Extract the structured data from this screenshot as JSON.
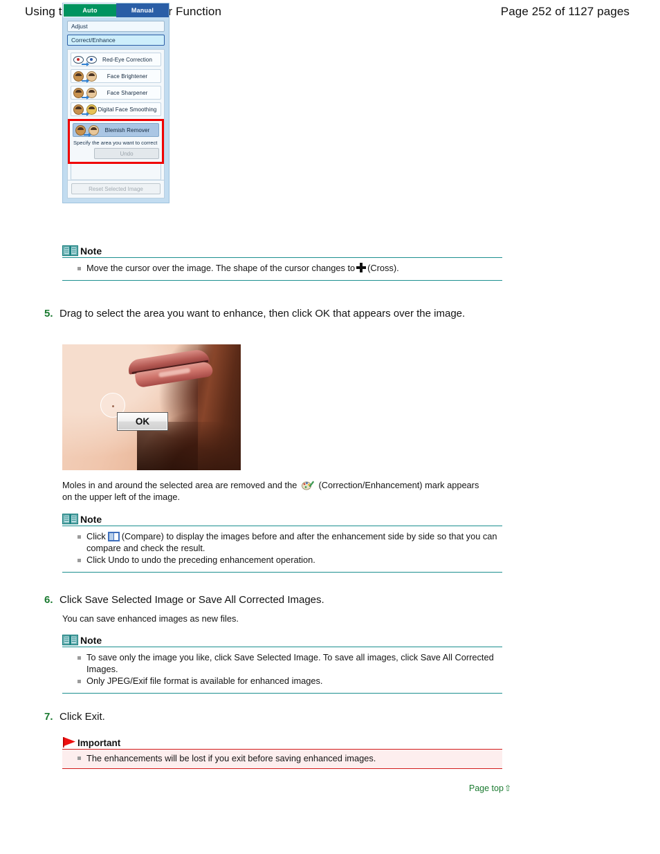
{
  "header": {
    "title": "Using the Blemish Remover Function",
    "page_label": "Page 252 of 1127 pages"
  },
  "app_panel": {
    "tabs": [
      {
        "label": "Auto",
        "selected": false,
        "color": "#00935f"
      },
      {
        "label": "Manual",
        "selected": true,
        "color": "#2a5ea6"
      }
    ],
    "mode_buttons": [
      {
        "label": "Adjust",
        "selected": false
      },
      {
        "label": "Correct/Enhance",
        "selected": true
      }
    ],
    "functions": [
      {
        "label": "Red-Eye Correction",
        "icon": "red-eye-icon",
        "active": false
      },
      {
        "label": "Face Brightener",
        "icon": "face-brightener-icon",
        "active": false
      },
      {
        "label": "Face Sharpener",
        "icon": "face-sharpener-icon",
        "active": false
      },
      {
        "label": "Digital Face Smoothing",
        "icon": "face-smoothing-icon",
        "active": false
      },
      {
        "label": "Blemish Remover",
        "icon": "blemish-remover-icon",
        "active": true
      }
    ],
    "hint": "Specify the area you want to correct",
    "undo_label": "Undo",
    "reset_label": "Reset Selected Image",
    "highlight_color": "#ef0000"
  },
  "note1": {
    "title": "Note",
    "icon": "book-icon",
    "items": [
      {
        "before": "Move the cursor over the image. The shape of the cursor changes to",
        "icon": "cross-cursor-icon",
        "after": "(Cross)."
      }
    ]
  },
  "step5": {
    "number": "5.",
    "text": "Drag to select the area you want to enhance, then click OK that appears over the image."
  },
  "photo": {
    "alt": "close-up photo of a face showing chin and lips with circular blemish selection",
    "ok_button_label": "OK"
  },
  "result_text": {
    "before": "Moles in and around the selected area are removed and the",
    "icon": "correction-enhancement-mark-icon",
    "after": "(Correction/Enhancement) mark appears on the upper left of the image."
  },
  "note2": {
    "title": "Note",
    "icon": "book-icon",
    "items": [
      {
        "before": "Click",
        "icon": "compare-icon",
        "after": "(Compare) to display the images before and after the enhancement side by side so that you can compare and check the result."
      },
      {
        "text": "Click Undo to undo the preceding enhancement operation."
      }
    ]
  },
  "step6": {
    "number": "6.",
    "text": "Click Save Selected Image or Save All Corrected Images.",
    "subtext": "You can save enhanced images as new files."
  },
  "note3": {
    "title": "Note",
    "icon": "book-icon",
    "items": [
      {
        "text": "To save only the image you like, click Save Selected Image. To save all images, click Save All Corrected Images."
      },
      {
        "text": "Only JPEG/Exif file format is available for enhanced images."
      }
    ]
  },
  "step7": {
    "number": "7.",
    "text": "Click Exit."
  },
  "important": {
    "title": "Important",
    "icon": "red-flag-icon",
    "items": [
      {
        "text": "The enhancements will be lost if you exit before saving enhanced images."
      }
    ]
  },
  "footer": {
    "page_top_label": "Page top",
    "page_top_arrow": "⇧"
  }
}
